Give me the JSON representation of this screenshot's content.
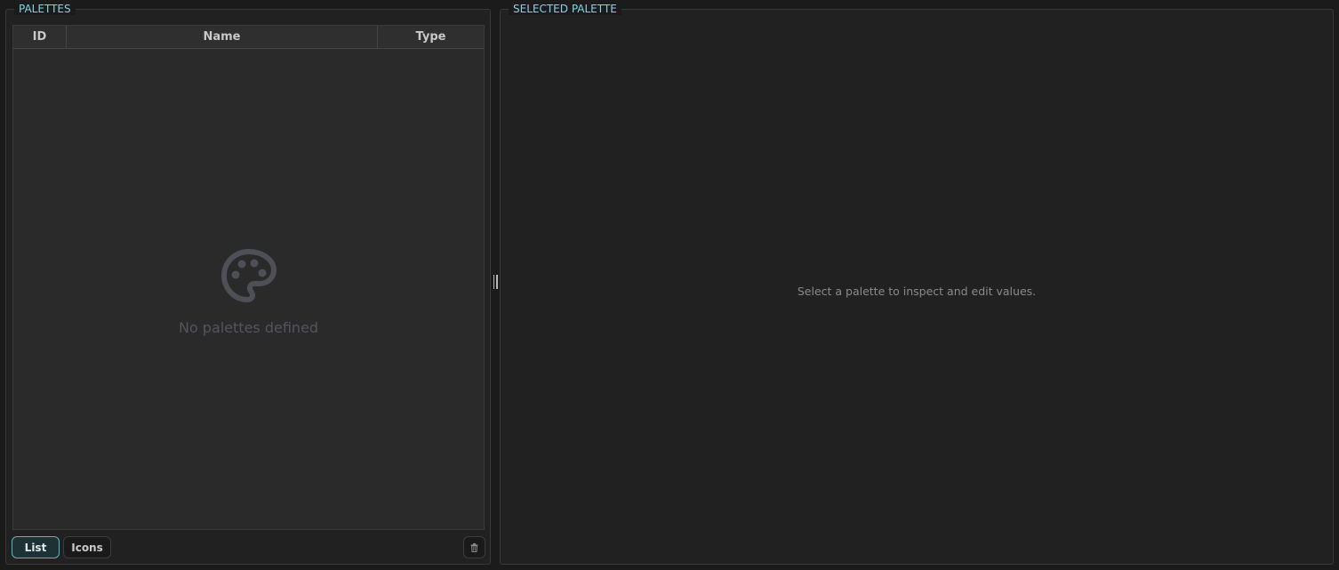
{
  "palettes_panel": {
    "title": "PALETTES",
    "columns": [
      "ID",
      "Name",
      "Type"
    ],
    "rows": [],
    "empty_icon": "palette-icon",
    "empty_message": "No palettes defined",
    "view_buttons": {
      "list_label": "List",
      "icons_label": "Icons",
      "active": "List"
    },
    "delete_icon": "trash-icon"
  },
  "selected_panel": {
    "title": "SELECTED PALETTE",
    "hint": "Select a palette to inspect and edit values."
  },
  "colors": {
    "accent": "#7fd6e3",
    "active_button_border": "#4fb8c4",
    "background": "#1b1b1b",
    "panel": "#212121"
  }
}
